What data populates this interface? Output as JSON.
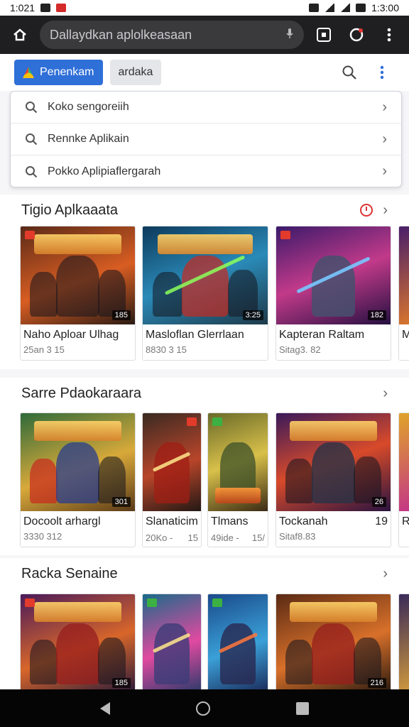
{
  "status_bar": {
    "time_left": "1:021",
    "time_right": "1:3:00"
  },
  "browser": {
    "url_text": "Dallaydkan aplolkeasaan",
    "mic_icon": "mic-icon"
  },
  "topbar": {
    "primary_label": "Penenkam",
    "chip_label": "ardaka"
  },
  "suggestions": [
    {
      "text": "Koko sengoreiih"
    },
    {
      "text": "Rennke Aplikain"
    },
    {
      "text": "Pokko Aplipiaflergarah"
    }
  ],
  "sections": [
    {
      "title": "Tigio Aplkaaata",
      "cards": [
        {
          "name": "Naho Aploar Ulhag",
          "meta": "25an 3 15",
          "badge": "185"
        },
        {
          "name": "Masloflan Glerrlaan",
          "meta": "8830 3 15",
          "badge": "3:25"
        },
        {
          "name": "Kapteran Raltam",
          "meta": "Sitag3. 82",
          "badge": "182"
        },
        {
          "name": "M",
          "meta": "",
          "badge": ""
        }
      ]
    },
    {
      "title": "Sarre Pdaokaraara",
      "cards": [
        {
          "name": "Docoolt arhargl",
          "meta": "3330 312",
          "badge": "301"
        },
        {
          "name": "Slanaticim",
          "meta": "20Ko -",
          "meta_right": "15",
          "badge": ""
        },
        {
          "name": "Tlmans",
          "meta": "49ide -",
          "meta_right": "15/",
          "badge": ""
        },
        {
          "name": "Tockanah",
          "name_right": "19",
          "meta": "Sitaf8.83",
          "badge": "26"
        },
        {
          "name": "Ri",
          "meta": "",
          "badge": ""
        }
      ]
    },
    {
      "title": "Racka Senaine",
      "cards": [
        {
          "name": "",
          "meta": "",
          "badge": "185"
        },
        {
          "name": "",
          "meta": "",
          "badge": ""
        },
        {
          "name": "",
          "meta": "",
          "badge": ""
        },
        {
          "name": "",
          "meta": "",
          "badge": "216"
        },
        {
          "name": "",
          "meta": "",
          "badge": ""
        }
      ]
    }
  ],
  "colors": {
    "primary": "#2f6fd8",
    "browser_bar": "#1f1f21",
    "accent_red": "#d33"
  }
}
